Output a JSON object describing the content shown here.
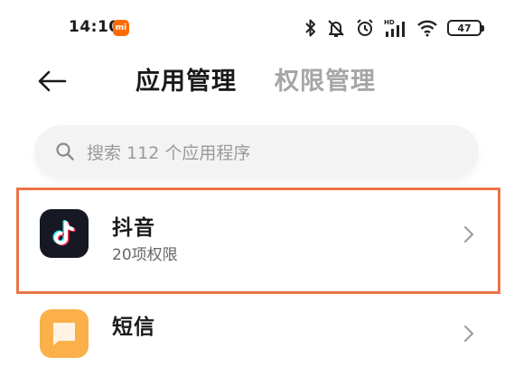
{
  "status_bar": {
    "time": "14:10",
    "mi_badge": "mi",
    "battery": "47",
    "hd_label": "HD",
    "icons": [
      "bluetooth-icon",
      "mute-icon",
      "alarm-icon",
      "cellular-signal-icon",
      "wifi-icon",
      "battery-icon"
    ]
  },
  "header": {
    "back_icon": "arrow-left-icon",
    "tabs": [
      {
        "label": "应用管理",
        "active": true
      },
      {
        "label": "权限管理",
        "active": false
      }
    ]
  },
  "search": {
    "placeholder": "搜索 112 个应用程序",
    "icon": "search-icon"
  },
  "apps": [
    {
      "name": "抖音",
      "subtitle": "20项权限",
      "icon": "douyin-icon",
      "highlighted": true
    },
    {
      "name": "短信",
      "subtitle": "",
      "icon": "sms-icon",
      "highlighted": false
    }
  ],
  "colors": {
    "highlight_border": "#ec7448",
    "tab_inactive": "#a6a6a6",
    "sms_icon_bg": "#fbb04a",
    "douyin_icon_bg": "#161823"
  }
}
